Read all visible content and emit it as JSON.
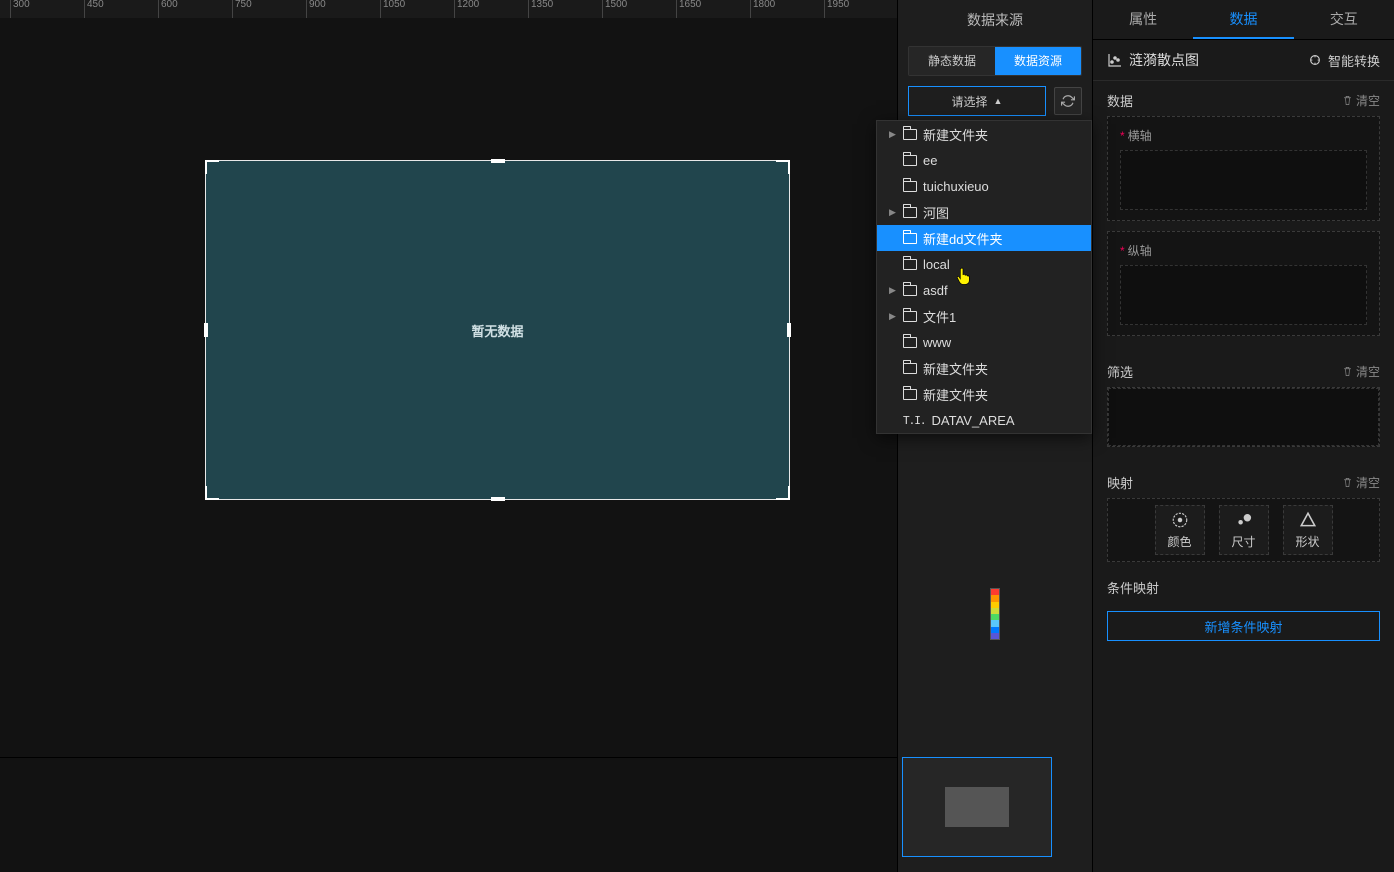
{
  "ruler_ticks": [
    "300",
    "450",
    "600",
    "750",
    "900",
    "1050",
    "1200",
    "1350",
    "1500",
    "1650",
    "1800",
    "1950"
  ],
  "canvas": {
    "no_data": "暂无数据"
  },
  "ds_panel": {
    "title": "数据来源",
    "tabs": {
      "static": "静态数据",
      "resource": "数据资源"
    },
    "select_placeholder": "请选择",
    "tree": [
      {
        "label": "新建文件夹",
        "expandable": true,
        "type": "folder"
      },
      {
        "label": "ee",
        "expandable": false,
        "type": "folder"
      },
      {
        "label": "tuichuxieuo",
        "expandable": false,
        "type": "folder"
      },
      {
        "label": "河图",
        "expandable": true,
        "type": "folder"
      },
      {
        "label": "新建dd文件夹",
        "expandable": false,
        "type": "folder",
        "selected": true
      },
      {
        "label": "local",
        "expandable": false,
        "type": "folder"
      },
      {
        "label": "asdf",
        "expandable": true,
        "type": "folder"
      },
      {
        "label": "文件1",
        "expandable": true,
        "type": "folder"
      },
      {
        "label": "www",
        "expandable": false,
        "type": "folder"
      },
      {
        "label": "新建文件夹",
        "expandable": false,
        "type": "folder"
      },
      {
        "label": "新建文件夹",
        "expandable": false,
        "type": "folder"
      },
      {
        "label": "DATAV_AREA",
        "expandable": false,
        "type": "table"
      }
    ]
  },
  "prop_panel": {
    "tabs": {
      "attr": "属性",
      "data": "数据",
      "interact": "交互"
    },
    "chart_type": "涟漪散点图",
    "smart_convert": "智能转换",
    "sections": {
      "data": {
        "title": "数据",
        "clear": "清空",
        "x_label": "横轴",
        "y_label": "纵轴"
      },
      "filter": {
        "title": "筛选",
        "clear": "清空"
      },
      "mapping": {
        "title": "映射",
        "clear": "清空",
        "color": "颜色",
        "size": "尺寸",
        "shape": "形状"
      },
      "cond": {
        "title": "条件映射",
        "add": "新增条件映射"
      }
    }
  }
}
